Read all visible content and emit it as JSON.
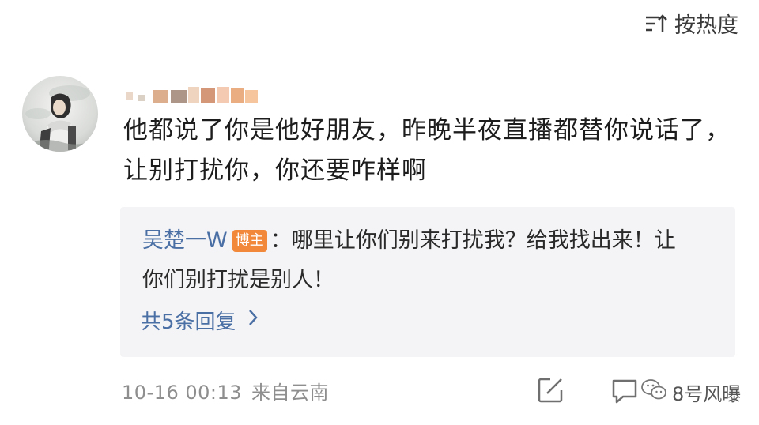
{
  "header": {
    "sort_label": "按热度",
    "sort_icon": "sort-icon"
  },
  "comment": {
    "text": "他都说了你是他好朋友，昨晚半夜直播都替你说话了，让别打扰你，你还要咋样啊",
    "avatar_icon": "avatar-illustration"
  },
  "reply": {
    "author": "吴楚一W",
    "badge": "博主",
    "text": "：哪里让你们别来打扰我？给我找出来！让你们别打扰是别人！",
    "count_label": "共5条回复",
    "chevron_icon": "chevron-right-icon",
    "author_color": "#4a6fa5",
    "badge_color": "#f2893a"
  },
  "footer": {
    "time": "10-16 00:13",
    "location": "来自云南",
    "edit_icon": "edit-icon",
    "comment_icon": "comment-icon"
  },
  "watermark": {
    "label": "8号风曝",
    "icon": "wechat-icon"
  }
}
